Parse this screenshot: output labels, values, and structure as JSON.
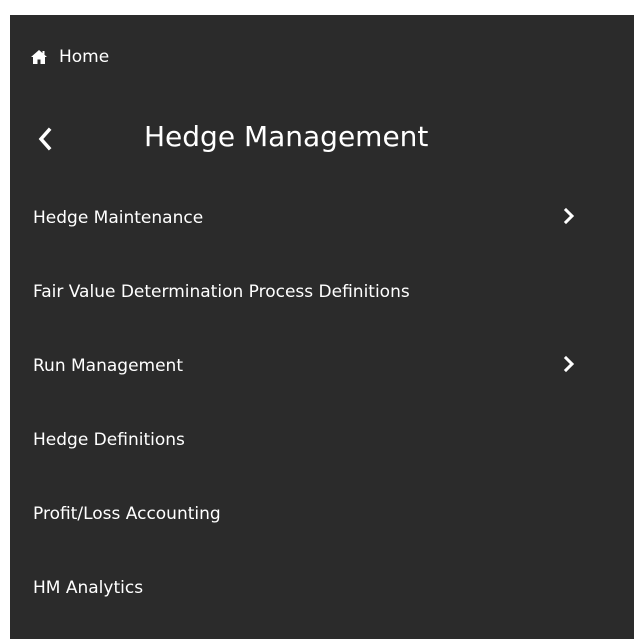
{
  "home": {
    "icon": "home-icon",
    "label": "Home"
  },
  "header": {
    "back_icon": "chevron-left-icon",
    "title": "Hedge Management"
  },
  "menu": {
    "items": [
      {
        "label": "Hedge Maintenance",
        "has_submenu": true
      },
      {
        "label": "Fair Value Determination Process Definitions",
        "has_submenu": false
      },
      {
        "label": "Run Management",
        "has_submenu": true
      },
      {
        "label": "Hedge Definitions",
        "has_submenu": false
      },
      {
        "label": "Profit/Loss Accounting",
        "has_submenu": false
      },
      {
        "label": "HM Analytics",
        "has_submenu": false
      }
    ]
  },
  "colors": {
    "panel_background": "#2b2b2b",
    "text": "#ffffff",
    "page_background": "#ffffff"
  }
}
